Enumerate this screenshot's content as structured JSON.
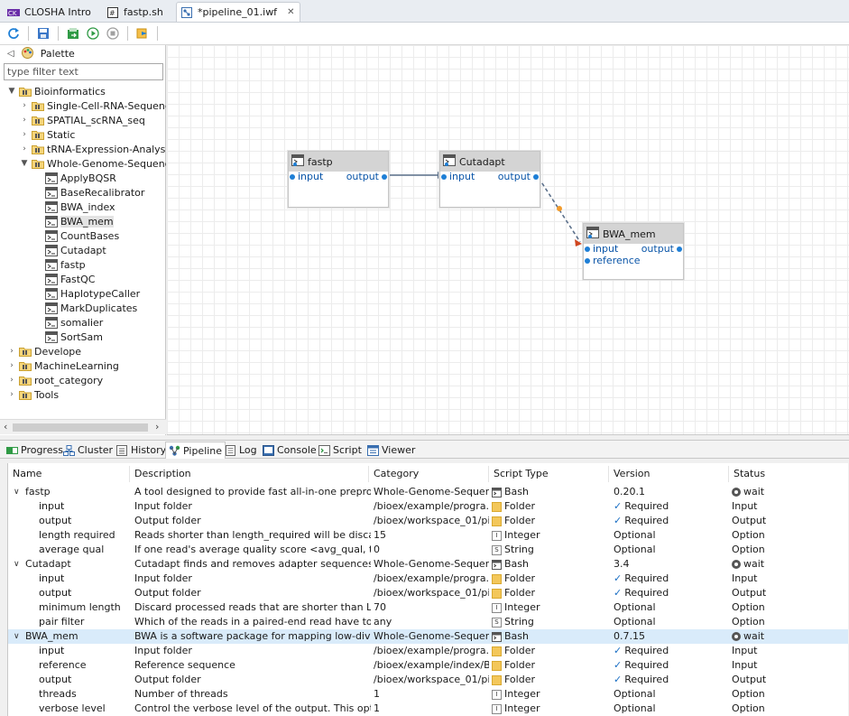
{
  "editor_tabs": [
    {
      "label": "CLOSHA Intro",
      "icon": "closha-icon"
    },
    {
      "label": "fastp.sh",
      "icon": "script-icon"
    },
    {
      "label": "*pipeline_01.iwf",
      "icon": "pipeline-icon",
      "active": true,
      "closable": true
    }
  ],
  "toolbar": {
    "buttons": [
      "refresh-icon",
      "save-icon",
      "export-icon",
      "run-icon",
      "stop-icon",
      "settings-icon"
    ]
  },
  "palette": {
    "title": "Palette",
    "filter_placeholder": "type filter text",
    "tree": {
      "root": "Bioinformatics",
      "children": [
        "Single-Cell-RNA-Sequencir",
        "SPATIAL_scRNA_seq",
        "Static",
        "tRNA-Expression-Analysis",
        "Whole-Genome-Sequencin"
      ],
      "wgs_tools": [
        "ApplyBQSR",
        "BaseRecalibrator",
        "BWA_index",
        "BWA_mem",
        "CountBases",
        "Cutadapt",
        "fastp",
        "FastQC",
        "HaplotypeCaller",
        "MarkDuplicates",
        "somalier",
        "SortSam"
      ],
      "selected_tool": "BWA_mem",
      "other_roots": [
        "Develope",
        "MachineLearning",
        "root_category",
        "Tools"
      ]
    }
  },
  "canvas": {
    "nodes": [
      {
        "title": "fastp",
        "inputs": [
          "input"
        ],
        "outputs": [
          "output"
        ]
      },
      {
        "title": "Cutadapt",
        "inputs": [
          "input"
        ],
        "outputs": [
          "output"
        ]
      },
      {
        "title": "BWA_mem",
        "inputs": [
          "input",
          "reference"
        ],
        "outputs": [
          "output"
        ]
      }
    ]
  },
  "view_tabs": [
    "Progress",
    "Cluster",
    "History",
    "Pipeline",
    "Log",
    "Console",
    "Script",
    "Viewer"
  ],
  "active_view": "Pipeline",
  "table": {
    "columns": [
      "Name",
      "Description",
      "Category",
      "Script Type",
      "Version",
      "Status"
    ],
    "rows": [
      {
        "level": 0,
        "name": "fastp",
        "desc": "A tool designed to provide fast all-in-one preproces...",
        "cat": "Whole-Genome-Sequen...",
        "type": "Bash",
        "ticon": "bash",
        "ver": "0.20.1",
        "status": "wait"
      },
      {
        "level": 1,
        "name": "input",
        "desc": "Input folder",
        "cat": "/bioex/example/progra...",
        "type": "Folder",
        "ticon": "folder",
        "ver": "Required",
        "check": true,
        "status": "Input"
      },
      {
        "level": 1,
        "name": "output",
        "desc": "Output folder",
        "cat": "/bioex/workspace_01/pi...",
        "type": "Folder",
        "ticon": "folder",
        "ver": "Required",
        "check": true,
        "status": "Output"
      },
      {
        "level": 1,
        "name": "length required",
        "desc": "Reads shorter than length_required will be discarded",
        "cat": "15",
        "type": "Integer",
        "ticon": "I",
        "ver": "Optional",
        "status": "Option"
      },
      {
        "level": 1,
        "name": "average qual",
        "desc": "If one read's average quality score <avg_qual, then t...",
        "cat": "0",
        "type": "String",
        "ticon": "S",
        "ver": "Optional",
        "status": "Option"
      },
      {
        "level": 0,
        "name": "Cutadapt",
        "desc": "Cutadapt finds and removes adapter sequences, pri...",
        "cat": "Whole-Genome-Sequen...",
        "type": "Bash",
        "ticon": "bash",
        "ver": "3.4",
        "status": "wait"
      },
      {
        "level": 1,
        "name": "input",
        "desc": "Input folder",
        "cat": "/bioex/example/progra...",
        "type": "Folder",
        "ticon": "folder",
        "ver": "Required",
        "check": true,
        "status": "Input"
      },
      {
        "level": 1,
        "name": "output",
        "desc": "Output folder",
        "cat": "/bioex/workspace_01/pi...",
        "type": "Folder",
        "ticon": "folder",
        "ver": "Required",
        "check": true,
        "status": "Output"
      },
      {
        "level": 1,
        "name": "minimum length",
        "desc": "Discard processed reads that are shorter than LENGTH",
        "cat": "70",
        "type": "Integer",
        "ticon": "I",
        "ver": "Optional",
        "status": "Option"
      },
      {
        "level": 1,
        "name": "pair filter",
        "desc": "Which of the reads in a paired-end read have to ma...",
        "cat": "any",
        "type": "String",
        "ticon": "S",
        "ver": "Optional",
        "status": "Option"
      },
      {
        "level": 0,
        "name": "BWA_mem",
        "desc": "BWA is a software package for mapping low-diverge...",
        "cat": "Whole-Genome-Sequen...",
        "type": "Bash",
        "ticon": "bash",
        "ver": "0.7.15",
        "status": "wait",
        "selected": true
      },
      {
        "level": 1,
        "name": "input",
        "desc": "Input folder",
        "cat": "/bioex/example/progra...",
        "type": "Folder",
        "ticon": "folder",
        "ver": "Required",
        "check": true,
        "status": "Input"
      },
      {
        "level": 1,
        "name": "reference",
        "desc": "Reference sequence",
        "cat": "/bioex/example/index/B...",
        "type": "Folder",
        "ticon": "folder",
        "ver": "Required",
        "check": true,
        "status": "Input"
      },
      {
        "level": 1,
        "name": "output",
        "desc": "Output folder",
        "cat": "/bioex/workspace_01/pi...",
        "type": "Folder",
        "ticon": "folder",
        "ver": "Required",
        "check": true,
        "status": "Output"
      },
      {
        "level": 1,
        "name": "threads",
        "desc": "Number of threads",
        "cat": "1",
        "type": "Integer",
        "ticon": "I",
        "ver": "Optional",
        "status": "Option"
      },
      {
        "level": 1,
        "name": "verbose level",
        "desc": "Control the verbose level of the output. This option ...",
        "cat": "1",
        "type": "Integer",
        "ticon": "I",
        "ver": "Optional",
        "status": "Option"
      }
    ]
  },
  "colors": {
    "accent": "#1e7fd6",
    "selection": "#d9ebfa",
    "folder": "#f3c75a"
  }
}
